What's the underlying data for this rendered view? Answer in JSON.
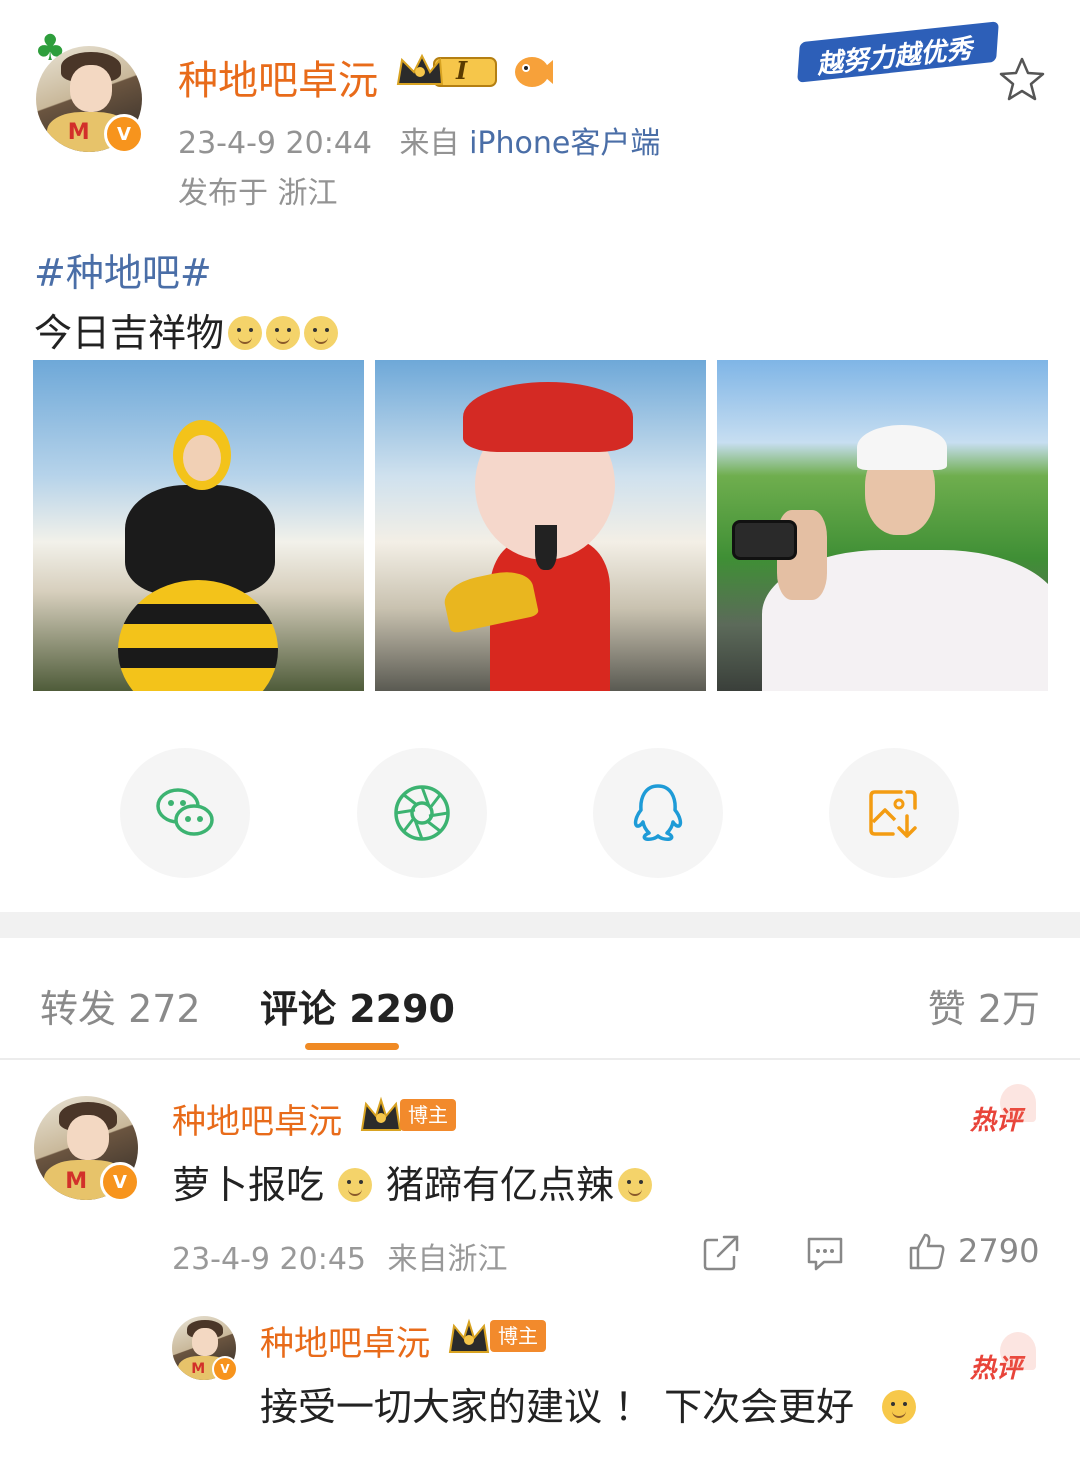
{
  "post": {
    "author": "种地吧卓沅",
    "level_badge": "I",
    "date": "23-4-9 20:44",
    "source_prefix": "来自",
    "source": "iPhone客户端",
    "location": "发布于 浙江",
    "hashtag": "#种地吧#",
    "text": "今日吉祥物",
    "campaign_banner": "越努力越优秀",
    "star_icon": "star-outline-icon"
  },
  "share": [
    {
      "name": "wechat-icon",
      "color": "#3cb371"
    },
    {
      "name": "moments-icon",
      "color": "#3cb371"
    },
    {
      "name": "qq-icon",
      "color": "#1e9bd7"
    },
    {
      "name": "save-image-icon",
      "color": "#f39c12"
    }
  ],
  "tabs": {
    "repost": "转发 272",
    "comment": "评论 2290",
    "like": "赞 2万"
  },
  "comments": [
    {
      "author": "种地吧卓沅",
      "tag": "博主",
      "hot": "热评",
      "text1": "萝卜报吃",
      "text2": "猪蹄有亿点辣",
      "date": "23-4-9 20:45",
      "location": "来自浙江",
      "likes": "2790"
    },
    {
      "author": "种地吧卓沅",
      "tag": "博主",
      "hot": "热评",
      "text": "接受一切大家的建议 ！ 下次会更好"
    }
  ],
  "colors": {
    "accent": "#e86b1a",
    "link": "#4a6ea7",
    "tab_underline": "#f08a24",
    "hot": "#e8443a"
  }
}
